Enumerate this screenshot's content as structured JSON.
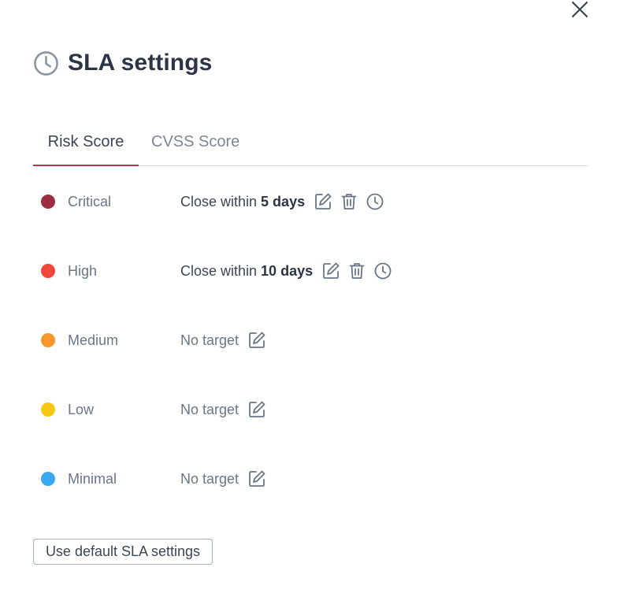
{
  "dialog": {
    "title": "SLA settings",
    "title_icon": "clock-icon",
    "close_icon": "close-icon"
  },
  "tabs": [
    {
      "label": "Risk Score",
      "active": true
    },
    {
      "label": "CVSS Score",
      "active": false
    }
  ],
  "levels": [
    {
      "name": "Critical",
      "color": "#9c2b3e",
      "target_prefix": "Close within",
      "target_value": "5 days",
      "actions": [
        "edit-icon",
        "trash-icon",
        "clock-icon"
      ]
    },
    {
      "name": "High",
      "color": "#f2463a",
      "target_prefix": "Close within",
      "target_value": "10 days",
      "actions": [
        "edit-icon",
        "trash-icon",
        "clock-icon"
      ]
    },
    {
      "name": "Medium",
      "color": "#f7962a",
      "target_text": "No target",
      "actions": [
        "edit-icon"
      ]
    },
    {
      "name": "Low",
      "color": "#f5c916",
      "target_text": "No target",
      "actions": [
        "edit-icon"
      ]
    },
    {
      "name": "Minimal",
      "color": "#3aa9f2",
      "target_text": "No target",
      "actions": [
        "edit-icon"
      ]
    }
  ],
  "footer": {
    "default_button_label": "Use default SLA settings"
  },
  "colors": {
    "accent": "#b23a48",
    "text": "#2b3545",
    "muted": "#6a7686",
    "icon": "#6a7686"
  }
}
